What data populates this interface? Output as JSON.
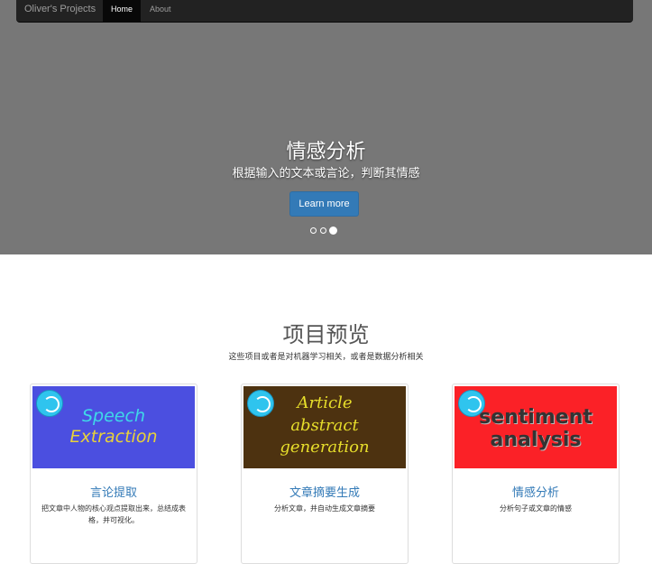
{
  "navbar": {
    "brand": "Oliver's Projects",
    "links": [
      {
        "label": "Home",
        "active": true
      },
      {
        "label": "About",
        "active": false
      }
    ]
  },
  "hero": {
    "title": "情感分析",
    "subtitle": "根据输入的文本或言论，判断其情感",
    "button_label": "Learn more",
    "indicator_count": 3,
    "active_indicator": 3,
    "background_color": "#777777"
  },
  "projects": {
    "title": "项目预览",
    "subtitle": "这些项目或者是对机器学习相关，或者是数据分析相关",
    "cards": [
      {
        "image_text_lines": [
          "Speech",
          "Extraction"
        ],
        "image_bg": "#4b4fe0",
        "title": "言论提取",
        "description": "把文章中人物的核心观点提取出来，总结成表格，并可视化。"
      },
      {
        "image_text_lines": [
          "Article",
          "abstract",
          "generation"
        ],
        "image_bg": "#4d3210",
        "title": "文章摘要生成",
        "description": "分析文章，并自动生成文章摘要"
      },
      {
        "image_text_lines": [
          "sentiment",
          "analysis"
        ],
        "image_bg": "#fb2127",
        "title": "情感分析",
        "description": "分析句子或文章的情感"
      }
    ]
  },
  "colors": {
    "accent": "#337ab7",
    "navbar": "#222222"
  }
}
